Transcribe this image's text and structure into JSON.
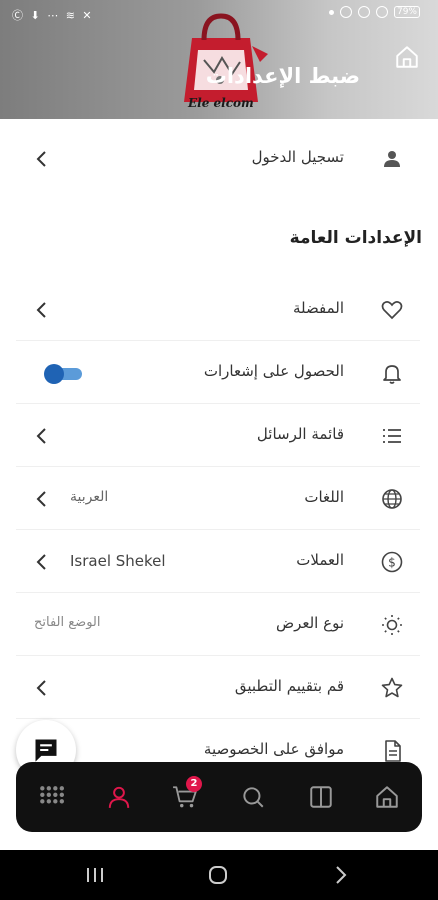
{
  "status_bar": {
    "left_icons": "Ⓒ ⬇ ⋯ ≋ ✕",
    "battery": "79%"
  },
  "header": {
    "title": "ضبط الإعدادات",
    "logo_text": "Ele elcom",
    "background": "#9a9a9a"
  },
  "login_row": {
    "label": "تسجيل الدخول",
    "icon": "person-icon"
  },
  "general_section": {
    "title": "الإعدادات العامة"
  },
  "rows": {
    "favorites": {
      "label": "المفضلة",
      "icon": "heart-icon"
    },
    "notifications": {
      "label": "الحصول على إشعارات",
      "icon": "bell-icon",
      "enabled": true
    },
    "messages": {
      "label": "قائمة الرسائل",
      "icon": "list-icon"
    },
    "languages": {
      "label": "اللغات",
      "value": "العربية",
      "icon": "globe-icon"
    },
    "currencies": {
      "label": "العملات",
      "value": "Israel Shekel",
      "icon": "dollar-circle-icon"
    },
    "display_mode": {
      "label": "نوع العرض",
      "value": "الوضع الفاتح",
      "icon": "sun-icon"
    },
    "rate_app": {
      "label": "قم بتقييم التطبيق",
      "icon": "star-icon"
    },
    "privacy": {
      "label": "موافق على الخصوصية",
      "icon": "document-icon"
    }
  },
  "bottom_nav": {
    "items": [
      "grid-icon",
      "profile-icon",
      "cart-icon",
      "search-icon",
      "split-view-icon",
      "home-icon"
    ],
    "cart_badge": "2",
    "active_color": "#e0174b"
  },
  "accent_color": "#1f63b4"
}
